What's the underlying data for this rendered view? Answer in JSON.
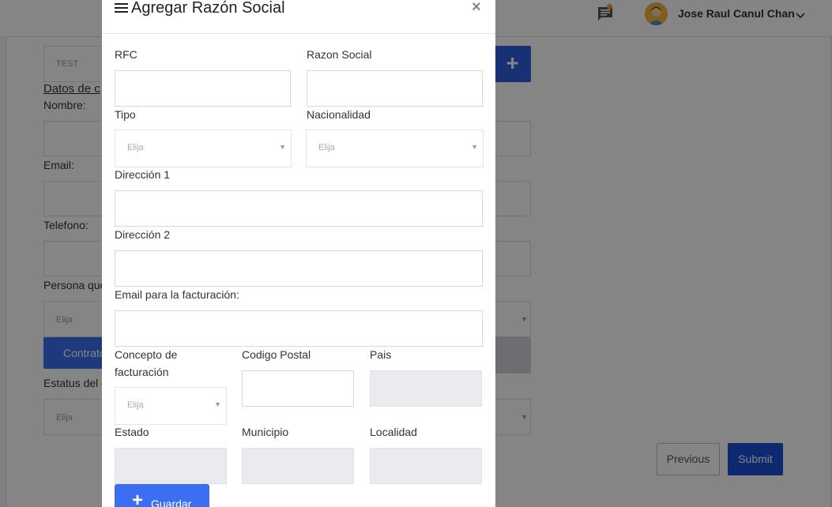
{
  "header": {
    "user_name": "Jose Raul Canul Chan",
    "icons": [
      "chat-icon",
      "avatar",
      "chevron-down-icon"
    ]
  },
  "background_form": {
    "test_value": "TEST",
    "datos_label": "Datos de c",
    "nombre_label": "Nombre:",
    "email_label": "Email:",
    "telefono_label": "Telefono:",
    "persona_label": "Persona que",
    "persona_select": "Elija",
    "contrato_button": "Contrato",
    "estatus_label": "Estatus del c",
    "estatus_select": "Elija",
    "previous_button": "Previous",
    "submit_button": "Submit"
  },
  "modal": {
    "title": "Agregar Razón Social",
    "close": "×",
    "fields": {
      "rfc": "RFC",
      "razon_social": "Razon Social",
      "tipo": "Tipo",
      "tipo_select": "Elija",
      "nacionalidad": "Nacionalidad",
      "nacionalidad_select": "Elija",
      "direccion1": "Dirección 1",
      "direccion2": "Dirección 2",
      "email_facturacion": "Email para la facturación:",
      "concepto_line1": "Concepto de",
      "concepto_line2": "facturación",
      "concepto_select": "Elija",
      "codigo_postal": "Codigo Postal",
      "pais": "Pais",
      "estado": "Estado",
      "municipio": "Municipio",
      "localidad": "Localidad"
    },
    "guardar_button": "Guardar"
  },
  "colors": {
    "primary": "#3b6ef0",
    "submit": "#1e4fd8",
    "disabled_field": "#e9ebee",
    "notification_dot": "#f0a12a"
  }
}
